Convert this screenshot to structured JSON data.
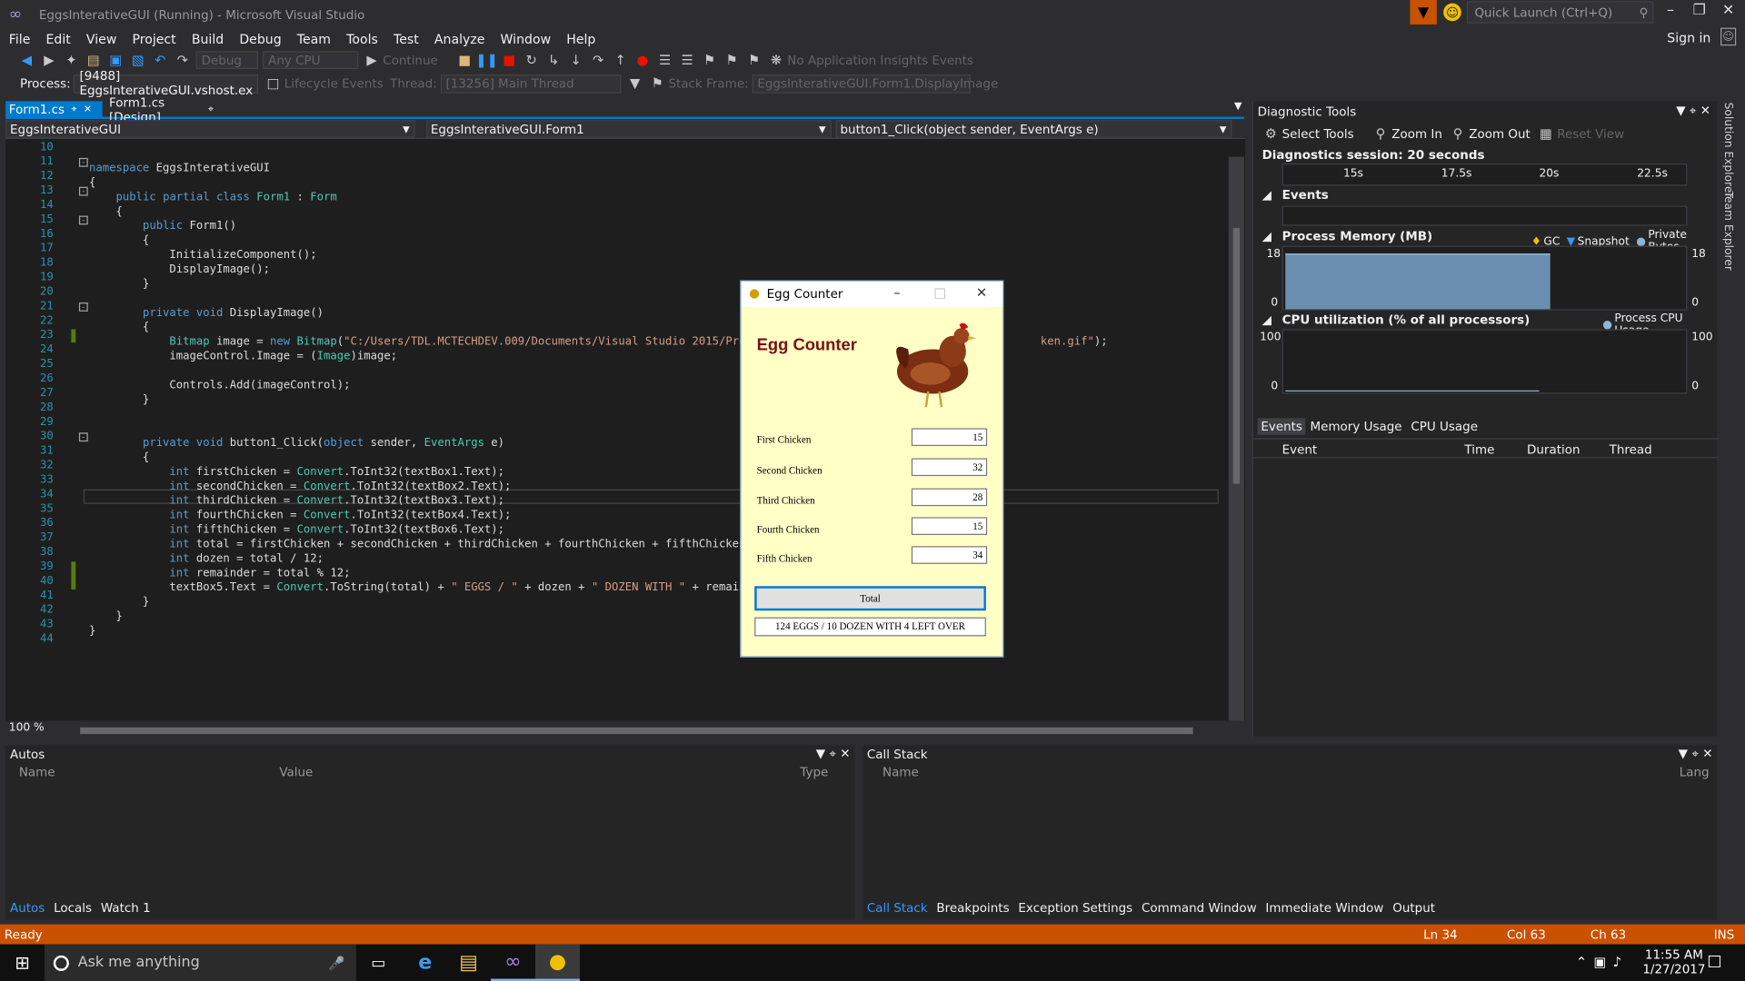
{
  "window": {
    "title": "EggsInterativeGUI (Running) - Microsoft Visual Studio",
    "quick_launch": "Quick Launch (Ctrl+Q)",
    "sign_in": "Sign in"
  },
  "menu": [
    "File",
    "Edit",
    "View",
    "Project",
    "Build",
    "Debug",
    "Team",
    "Tools",
    "Test",
    "Analyze",
    "Window",
    "Help"
  ],
  "toolbar": {
    "config": "Debug",
    "platform": "Any CPU",
    "continue": "Continue",
    "insights": "No Application Insights Events"
  },
  "debugbar": {
    "process_label": "Process:",
    "process": "[9488] EggsInterativeGUI.vshost.ex",
    "lifecycle": "Lifecycle Events",
    "thread_label": "Thread:",
    "thread": "[13256] Main Thread",
    "stack_label": "Stack Frame:",
    "stack": "EggsInterativeGUI.Form1.DisplayImage"
  },
  "tabs": [
    {
      "label": "Form1.cs"
    },
    {
      "label": "Form1.cs [Design]"
    }
  ],
  "nav": {
    "project": "EggsInterativeGUI",
    "class": "EggsInterativeGUI.Form1",
    "member": "button1_Click(object sender, EventArgs e)"
  },
  "editor": {
    "lines": [
      "10",
      "11",
      "12",
      "13",
      "14",
      "15",
      "16",
      "17",
      "18",
      "19",
      "20",
      "21",
      "22",
      "23",
      "24",
      "25",
      "26",
      "27",
      "28",
      "29",
      "30",
      "31",
      "32",
      "33",
      "34",
      "35",
      "36",
      "37",
      "38",
      "39",
      "40",
      "41",
      "42",
      "43",
      "44"
    ],
    "zoom": "100 %"
  },
  "diagnostics": {
    "title": "Diagnostic Tools",
    "select_tools": "Select Tools",
    "zoom_in": "Zoom In",
    "zoom_out": "Zoom Out",
    "reset_view": "Reset View",
    "session": "Diagnostics session: 20 seconds",
    "timeline": [
      "15s",
      "17.5s",
      "20s",
      "22.5s"
    ],
    "events": "Events",
    "memory_title": "Process Memory (MB)",
    "gc": "GC",
    "snapshot": "Snapshot",
    "private_bytes": "Private Bytes",
    "mem_max": "18",
    "mem_min": "0",
    "cpu_title": "CPU utilization (% of all processors)",
    "cpu_legend": "Process CPU Usage",
    "cpu_max": "100",
    "cpu_min": "0",
    "tabs": [
      "Events",
      "Memory Usage",
      "CPU Usage"
    ],
    "columns": [
      "Event",
      "Time",
      "Duration",
      "Thread"
    ]
  },
  "side_tabs": [
    "Solution Explorer",
    "Team Explorer"
  ],
  "autos": {
    "title": "Autos",
    "columns": [
      "Name",
      "Value",
      "Type"
    ],
    "tabs": [
      "Autos",
      "Locals",
      "Watch 1"
    ]
  },
  "callstack": {
    "title": "Call Stack",
    "columns": [
      "Name",
      "Lang"
    ],
    "tabs": [
      "Call Stack",
      "Breakpoints",
      "Exception Settings",
      "Command Window",
      "Immediate Window",
      "Output"
    ]
  },
  "status": {
    "ready": "Ready",
    "ln": "Ln 34",
    "col": "Col 63",
    "ch": "Ch 63",
    "ins": "INS"
  },
  "taskbar": {
    "search": "Ask me anything",
    "time": "11:55 AM",
    "date": "1/27/2017"
  },
  "egg_form": {
    "title": "Egg Counter",
    "heading": "Egg Counter",
    "fields": [
      {
        "label": "First Chicken",
        "value": "15"
      },
      {
        "label": "Second Chicken",
        "value": "32"
      },
      {
        "label": "Third Chicken",
        "value": "28"
      },
      {
        "label": "Fourth Chicken",
        "value": "15"
      },
      {
        "label": "Fifth Chicken",
        "value": "34"
      }
    ],
    "total_button": "Total",
    "result": "124 EGGS / 10 DOZEN WITH 4 LEFT OVER"
  },
  "colors": {
    "accent": "#007acc",
    "status_bar": "#ca5100",
    "form_bg": "#ffffc6"
  }
}
